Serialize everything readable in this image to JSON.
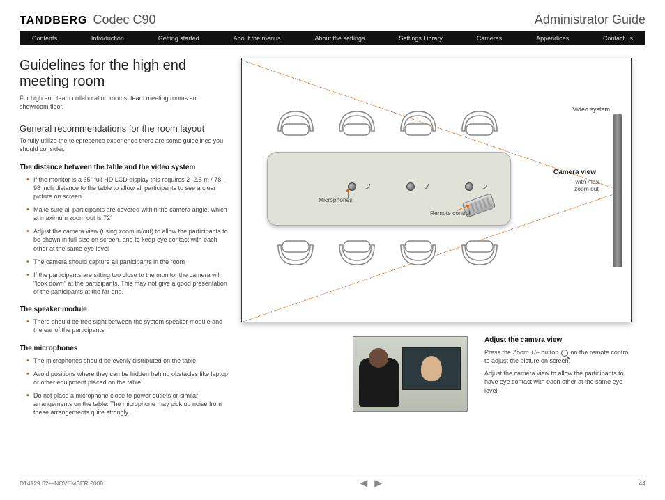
{
  "header": {
    "brand": "TANDBERG",
    "product": "Codec C90",
    "admin_guide": "Administrator Guide"
  },
  "nav": {
    "items": [
      "Contents",
      "Introduction",
      "Getting started",
      "About the menus",
      "About the settings",
      "Settings Library",
      "Cameras",
      "Appendices",
      "Contact us"
    ]
  },
  "main": {
    "title": "Guidelines for the high end meeting room",
    "subtitle": "For high end team collaboration rooms, team meeting rooms and showroom floor.",
    "rec_heading": "General recommendations for the room layout",
    "rec_sub": "To fully utilize the telepresence experience there are some guidelines you should consider.",
    "distance_heading": "The distance between the table and the video system",
    "distance_items": [
      "If the monitor is a 65\" full HD LCD display this requires 2–2,5 m / 78–98 inch distance to the table to allow all participants to see a clear picture on screen",
      "Make sure all participants are covered within the camera angle, which at maximum zoom out is 72°",
      "Adjust the camera view (using zoom in/out) to allow the participants to be shown in full size on screen, and to keep eye contact with each other at the same eye level",
      "The camera should capture all participants in the room",
      "If the participants are sitting too close to the monitor the camera will \"look down\" at the participants. This may not give a good presentation of the participants at the far end."
    ],
    "speaker_heading": "The speaker module",
    "speaker_items": [
      "There should be free sight between the system speaker module and the ear of the participants."
    ],
    "mic_heading": "The microphones",
    "mic_items": [
      "The microphones should be evenly distributed on the table",
      "Avoid positions where they can be hidden behind obstacles like laptop or other equipment placed on the table",
      "Do not place a microphone close to power outlets or similar arrangements on the table. The microphone may pick up noise from these arrangements quite strongly."
    ]
  },
  "diagram": {
    "video_system": "Video system",
    "camera_view": "Camera view",
    "camera_sub": "- with max zoom out",
    "microphones": "Microphones",
    "remote": "Remote control"
  },
  "adjust": {
    "heading": "Adjust the camera view",
    "p1a": "Press the Zoom +/– button ",
    "p1b": " on the remote control to adjust the picture on screen.",
    "p2": "Adjust the camera view to allow the participants to have eye contact with each other at the same eye level."
  },
  "footer": {
    "doc": "D14129.02—NOVEMBER 2008",
    "page": "44"
  }
}
